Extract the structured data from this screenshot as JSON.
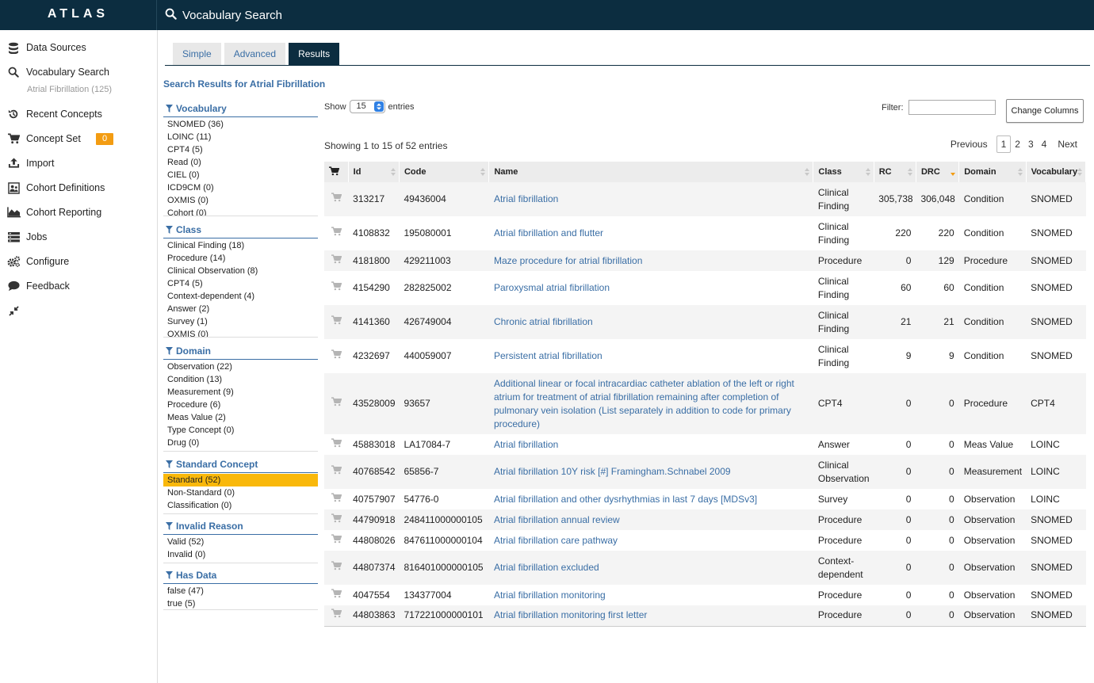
{
  "app": {
    "brand": "ATLAS",
    "page_title": "Vocabulary Search"
  },
  "nav": {
    "items": [
      {
        "label": "Data Sources",
        "icon": "database-icon"
      },
      {
        "label": "Vocabulary Search",
        "icon": "search-icon"
      },
      {
        "label": "Recent Concepts",
        "icon": "history-icon"
      },
      {
        "label": "Concept Set",
        "icon": "cart-icon"
      },
      {
        "label": "Import",
        "icon": "upload-icon"
      },
      {
        "label": "Cohort Definitions",
        "icon": "cohort-icon"
      },
      {
        "label": "Cohort Reporting",
        "icon": "area-chart-icon"
      },
      {
        "label": "Jobs",
        "icon": "list-icon"
      },
      {
        "label": "Configure",
        "icon": "gears-icon"
      },
      {
        "label": "Feedback",
        "icon": "comment-icon"
      }
    ],
    "search_sub": "Atrial Fibrillation (125)",
    "concept_set_count": "0"
  },
  "tabs": [
    "Simple",
    "Advanced",
    "Results"
  ],
  "results_title": "Search Results for Atrial Fibrillation",
  "facets": [
    {
      "title": "Vocabulary",
      "items": [
        "SNOMED (36)",
        "LOINC (11)",
        "CPT4 (5)",
        "Read (0)",
        "CIEL (0)",
        "ICD9CM (0)",
        "OXMIS (0)",
        "Cohort (0)"
      ]
    },
    {
      "title": "Class",
      "items": [
        "Clinical Finding (18)",
        "Procedure (14)",
        "Clinical Observation (8)",
        "CPT4 (5)",
        "Context-dependent (4)",
        "Answer (2)",
        "Survey (1)",
        "OXMIS (0)"
      ]
    },
    {
      "title": "Domain",
      "items": [
        "Observation (22)",
        "Condition (13)",
        "Measurement (9)",
        "Procedure (6)",
        "Meas Value (2)",
        "Type Concept (0)",
        "Drug (0)"
      ]
    },
    {
      "title": "Standard Concept",
      "items": [
        "Standard (52)",
        "Non-Standard (0)",
        "Classification (0)"
      ]
    },
    {
      "title": "Invalid Reason",
      "items": [
        "Valid (52)",
        "Invalid (0)"
      ]
    },
    {
      "title": "Has Data",
      "items": [
        "false (47)",
        "true (5)"
      ]
    }
  ],
  "controls": {
    "show_label": "Show",
    "page_size": "15",
    "entries_label": "entries",
    "filter_label": "Filter:",
    "filter_value": "",
    "change_columns": "Change Columns",
    "info": "Showing 1 to 15 of 52 entries",
    "pager": [
      "Previous",
      "1",
      "2",
      "3",
      "4",
      "Next"
    ]
  },
  "table": {
    "columns": [
      "Id",
      "Code",
      "Name",
      "Class",
      "RC",
      "DRC",
      "Domain",
      "Vocabulary"
    ],
    "rows": [
      [
        "313217",
        "49436004",
        "Atrial fibrillation",
        "Clinical Finding",
        "305,738",
        "306,048",
        "Condition",
        "SNOMED"
      ],
      [
        "4108832",
        "195080001",
        "Atrial fibrillation and flutter",
        "Clinical Finding",
        "220",
        "220",
        "Condition",
        "SNOMED"
      ],
      [
        "4181800",
        "429211003",
        "Maze procedure for atrial fibrillation",
        "Procedure",
        "0",
        "129",
        "Procedure",
        "SNOMED"
      ],
      [
        "4154290",
        "282825002",
        "Paroxysmal atrial fibrillation",
        "Clinical Finding",
        "60",
        "60",
        "Condition",
        "SNOMED"
      ],
      [
        "4141360",
        "426749004",
        "Chronic atrial fibrillation",
        "Clinical Finding",
        "21",
        "21",
        "Condition",
        "SNOMED"
      ],
      [
        "4232697",
        "440059007",
        "Persistent atrial fibrillation",
        "Clinical Finding",
        "9",
        "9",
        "Condition",
        "SNOMED"
      ],
      [
        "43528009",
        "93657",
        "Additional linear or focal intracardiac catheter ablation of the left or right atrium for treatment of atrial fibrillation remaining after completion of pulmonary vein isolation (List separately in addition to code for primary procedure)",
        "CPT4",
        "0",
        "0",
        "Procedure",
        "CPT4"
      ],
      [
        "45883018",
        "LA17084-7",
        "Atrial fibrillation",
        "Answer",
        "0",
        "0",
        "Meas Value",
        "LOINC"
      ],
      [
        "40768542",
        "65856-7",
        "Atrial fibrillation 10Y risk [#] Framingham.Schnabel 2009",
        "Clinical Observation",
        "0",
        "0",
        "Measurement",
        "LOINC"
      ],
      [
        "40757907",
        "54776-0",
        "Atrial fibrillation and other dysrhythmias in last 7 days [MDSv3]",
        "Survey",
        "0",
        "0",
        "Observation",
        "LOINC"
      ],
      [
        "44790918",
        "248411000000105",
        "Atrial fibrillation annual review",
        "Procedure",
        "0",
        "0",
        "Observation",
        "SNOMED"
      ],
      [
        "44808026",
        "847611000000104",
        "Atrial fibrillation care pathway",
        "Procedure",
        "0",
        "0",
        "Observation",
        "SNOMED"
      ],
      [
        "44807374",
        "816401000000105",
        "Atrial fibrillation excluded",
        "Context-dependent",
        "0",
        "0",
        "Observation",
        "SNOMED"
      ],
      [
        "4047554",
        "134377004",
        "Atrial fibrillation monitoring",
        "Procedure",
        "0",
        "0",
        "Observation",
        "SNOMED"
      ],
      [
        "44803863",
        "717221000000101",
        "Atrial fibrillation monitoring first letter",
        "Procedure",
        "0",
        "0",
        "Observation",
        "SNOMED"
      ]
    ]
  },
  "colors": {
    "topbar": "#0c2d40",
    "link": "#3a6ea5",
    "badge": "#f39c12",
    "selected_facet": "#f9b80b",
    "sort_active": "#f39c12"
  }
}
